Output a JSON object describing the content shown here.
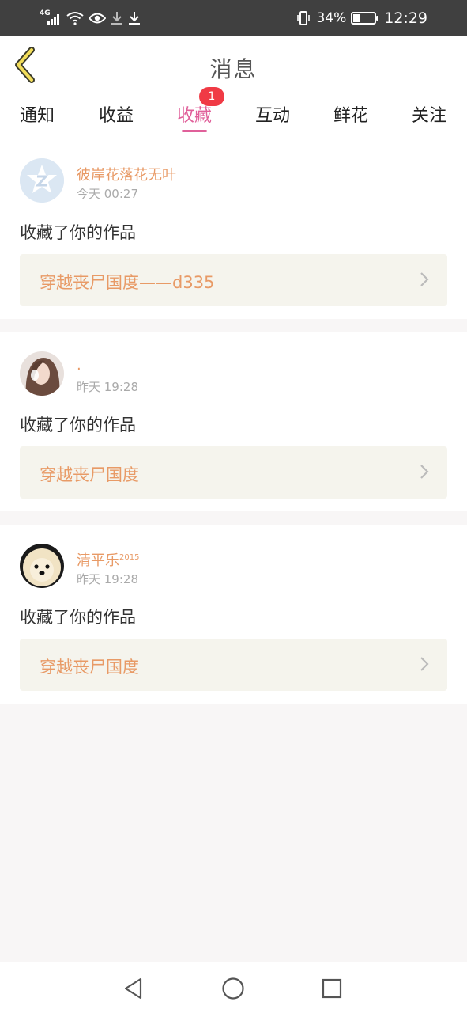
{
  "status_bar": {
    "network": "4G",
    "battery_percent": "34%",
    "battery_level": 0.34,
    "time": "12:29",
    "icons": [
      "signal-icon",
      "wifi-icon",
      "eye-icon",
      "download-icon",
      "download-icon",
      "vibrate-icon",
      "battery-icon"
    ]
  },
  "header": {
    "title": "消息",
    "back_icon": "chevron-left-icon"
  },
  "tabs": [
    {
      "label": "通知"
    },
    {
      "label": "收益"
    },
    {
      "label": "收藏",
      "active": true,
      "badge": "1"
    },
    {
      "label": "互动"
    },
    {
      "label": "鲜花"
    },
    {
      "label": "关注"
    }
  ],
  "feed": [
    {
      "user": "彼岸花落花无叶",
      "user_sup": "",
      "time": "今天 00:27",
      "action": "收藏了你的作品",
      "work_title": "穿越丧尸国度——d335"
    },
    {
      "user": ".",
      "user_sup": "",
      "time": "昨天 19:28",
      "action": "收藏了你的作品",
      "work_title": "穿越丧尸国度"
    },
    {
      "user": "清平乐",
      "user_sup": "2015",
      "time": "昨天 19:28",
      "action": "收藏了你的作品",
      "work_title": "穿越丧尸国度"
    }
  ],
  "colors": {
    "accent": "#e0609a",
    "username": "#e89a66",
    "badge": "#f03a45",
    "link_bg": "#f5f4ed"
  },
  "nav": {
    "icons": [
      "back-triangle-icon",
      "home-circle-icon",
      "recents-square-icon"
    ]
  }
}
